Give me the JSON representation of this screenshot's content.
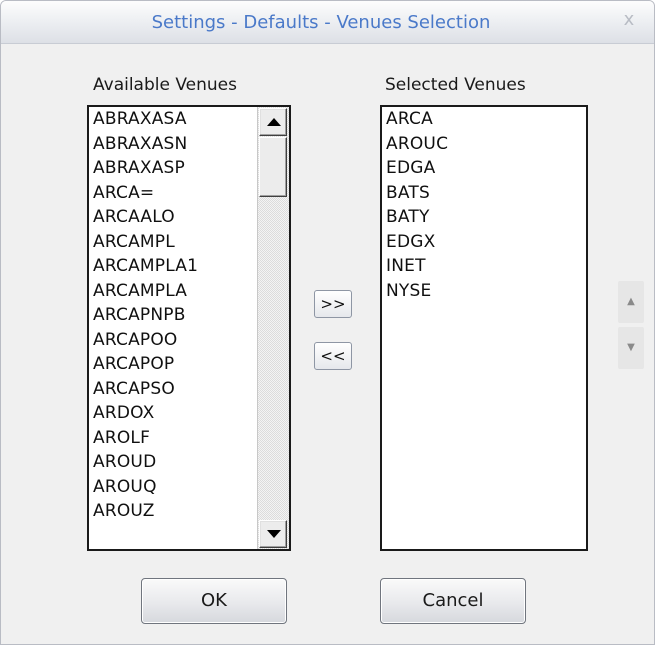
{
  "window": {
    "title": "Settings - Defaults - Venues Selection",
    "close_glyph": "x"
  },
  "available": {
    "label": "Available Venues",
    "items": [
      "ABRAXASA",
      "ABRAXASN",
      "ABRAXASP",
      "ARCA=",
      "ARCAALO",
      "ARCAMPL",
      "ARCAMPLA1",
      "ARCAMPLA",
      "ARCAPNPB",
      "ARCAPOO",
      "ARCAPOP",
      "ARCAPSO",
      "ARDOX",
      "AROLF",
      "AROUD",
      "AROUQ",
      "AROUZ"
    ]
  },
  "selected": {
    "label": "Selected Venues",
    "items": [
      "ARCA",
      "AROUC",
      "EDGA",
      "BATS",
      "BATY",
      "EDGX",
      "INET",
      "NYSE"
    ]
  },
  "transfer": {
    "add_label": ">>",
    "remove_label": "<<"
  },
  "order": {
    "up_glyph": "▲",
    "down_glyph": "▼"
  },
  "buttons": {
    "ok_label": "OK",
    "cancel_label": "Cancel"
  },
  "icons": {
    "close": "close-icon",
    "scroll_up": "arrow-up-icon",
    "scroll_down": "arrow-down-icon",
    "move_up": "arrow-up-icon",
    "move_down": "arrow-down-icon"
  },
  "colors": {
    "title_text": "#4a79c9",
    "dialog_bg": "#f0f0f0",
    "list_bg": "#ffffff"
  }
}
